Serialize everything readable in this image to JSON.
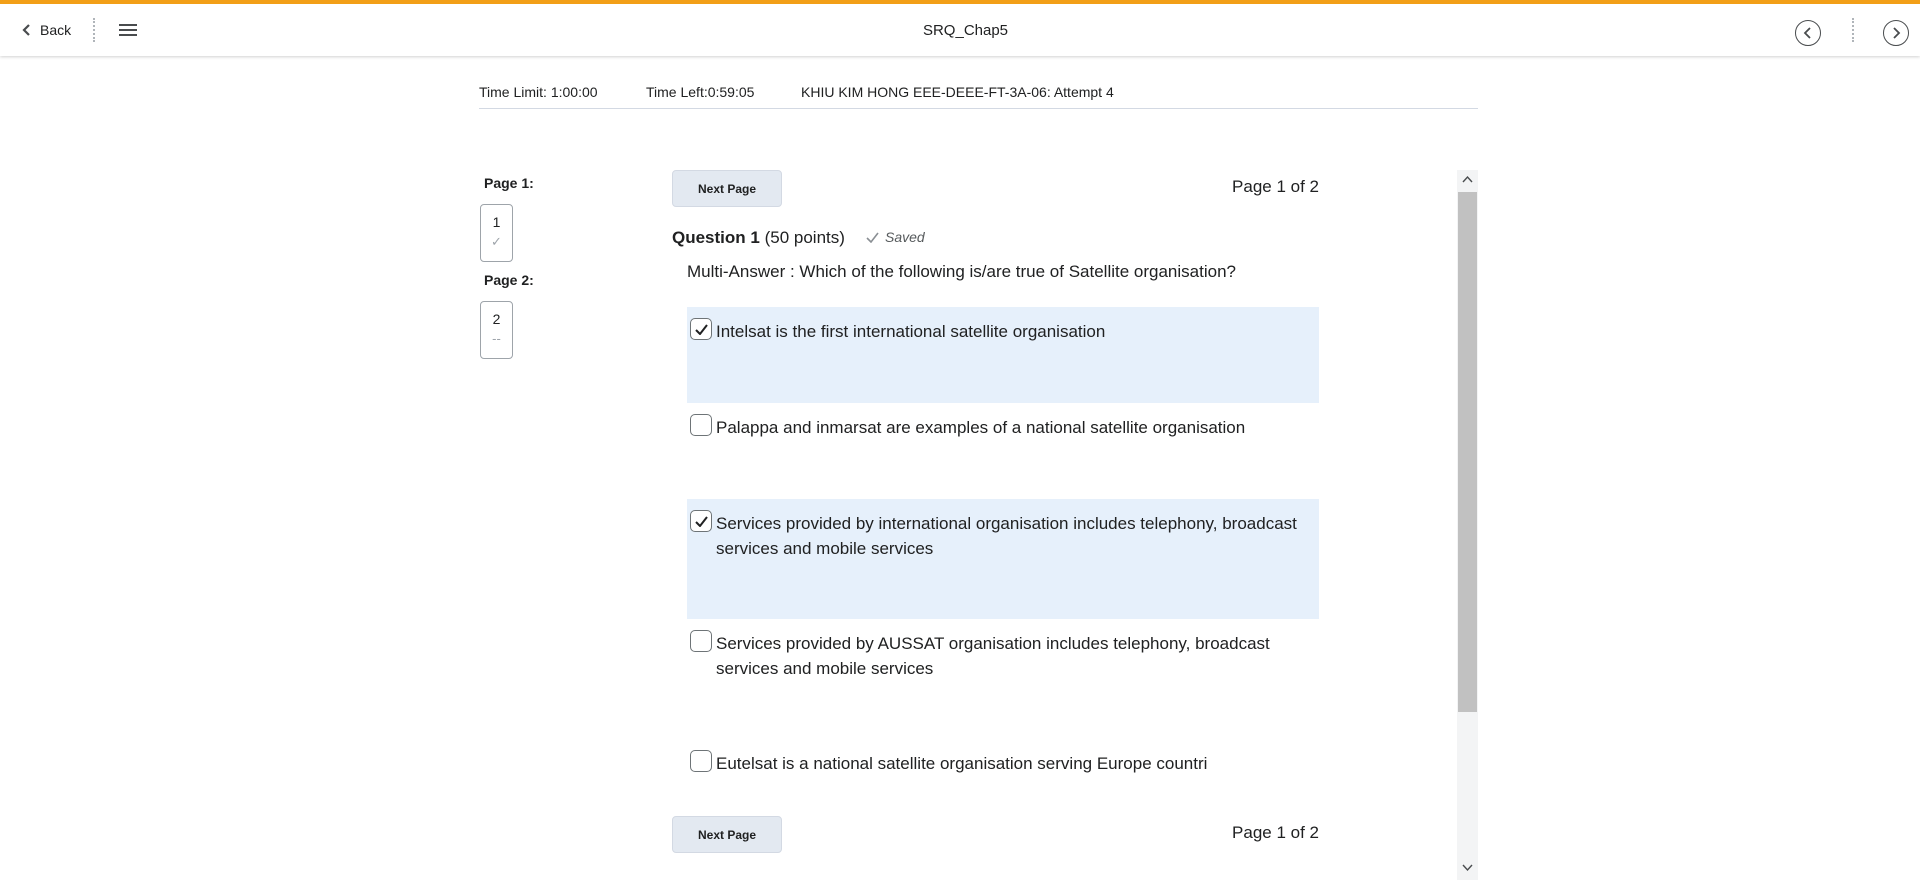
{
  "header": {
    "back_label": "Back",
    "title": "SRQ_Chap5",
    "accent_color": "#f29f18"
  },
  "info": {
    "time_limit": "Time Limit: 1:00:00",
    "time_left": "Time Left:0:59:05",
    "attempt": "KHIU KIM HONG EEE-DEEE-FT-3A-06: Attempt 4"
  },
  "sidebar": {
    "pages": [
      {
        "label": "Page 1:",
        "question_number": "1",
        "status": "✓"
      },
      {
        "label": "Page 2:",
        "question_number": "2",
        "status": "--"
      }
    ]
  },
  "main": {
    "next_page_label": "Next Page",
    "page_indicator": "Page 1 of 2",
    "question": {
      "title": "Question 1",
      "points": "(50 points)",
      "saved_label": "Saved",
      "text": "Multi-Answer : Which of the following is/are true of Satellite organisation?",
      "options": [
        {
          "label": "Intelsat is the first international satellite organisation",
          "checked": true
        },
        {
          "label": "Palappa and inmarsat are examples of a national satellite organisation",
          "checked": false
        },
        {
          "label": "Services provided by international organisation includes telephony, broadcast services and mobile services",
          "checked": true
        },
        {
          "label": "Services provided by AUSSAT organisation includes telephony, broadcast services and mobile services",
          "checked": false
        },
        {
          "label": "Eutelsat is a national satellite organisation serving Europe countri",
          "checked": false
        }
      ]
    }
  }
}
